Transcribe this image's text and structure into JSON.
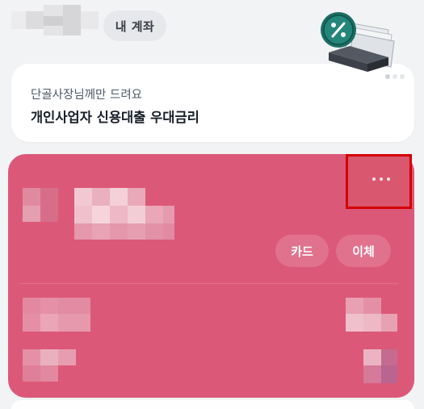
{
  "header": {
    "my_account_label": "내 계좌"
  },
  "promo": {
    "subtitle": "단골사장님께만 드려요",
    "title": "개인사업자 신용대출 우대금리"
  },
  "account_card": {
    "card_button_label": "카드",
    "transfer_button_label": "이체",
    "card_color": "#dc5878"
  },
  "icons": {
    "more": "more-horizontal-icon",
    "promo": "percent-coin-money-icon"
  }
}
